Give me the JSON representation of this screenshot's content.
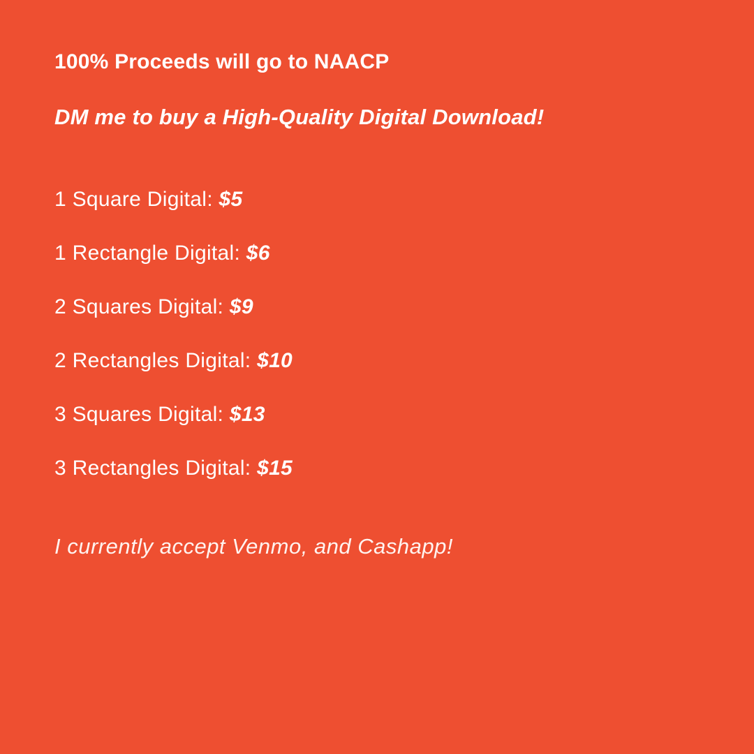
{
  "headline": "100% Proceeds will go to NAACP",
  "subhead": "DM me to buy a High-Quality Digital Download!",
  "prices": [
    {
      "label": "1 Square Digital: ",
      "value": "$5"
    },
    {
      "label": "1 Rectangle Digital: ",
      "value": "$6"
    },
    {
      "label": "2 Squares Digital: ",
      "value": "$9"
    },
    {
      "label": "2 Rectangles Digital: ",
      "value": "$10"
    },
    {
      "label": "3 Squares Digital: ",
      "value": "$13"
    },
    {
      "label": "3 Rectangles Digital: ",
      "value": "$15"
    }
  ],
  "footer_note": "I currently accept Venmo, and Cashapp!",
  "colors": {
    "background": "#ee4f31",
    "text": "#ffffff"
  }
}
